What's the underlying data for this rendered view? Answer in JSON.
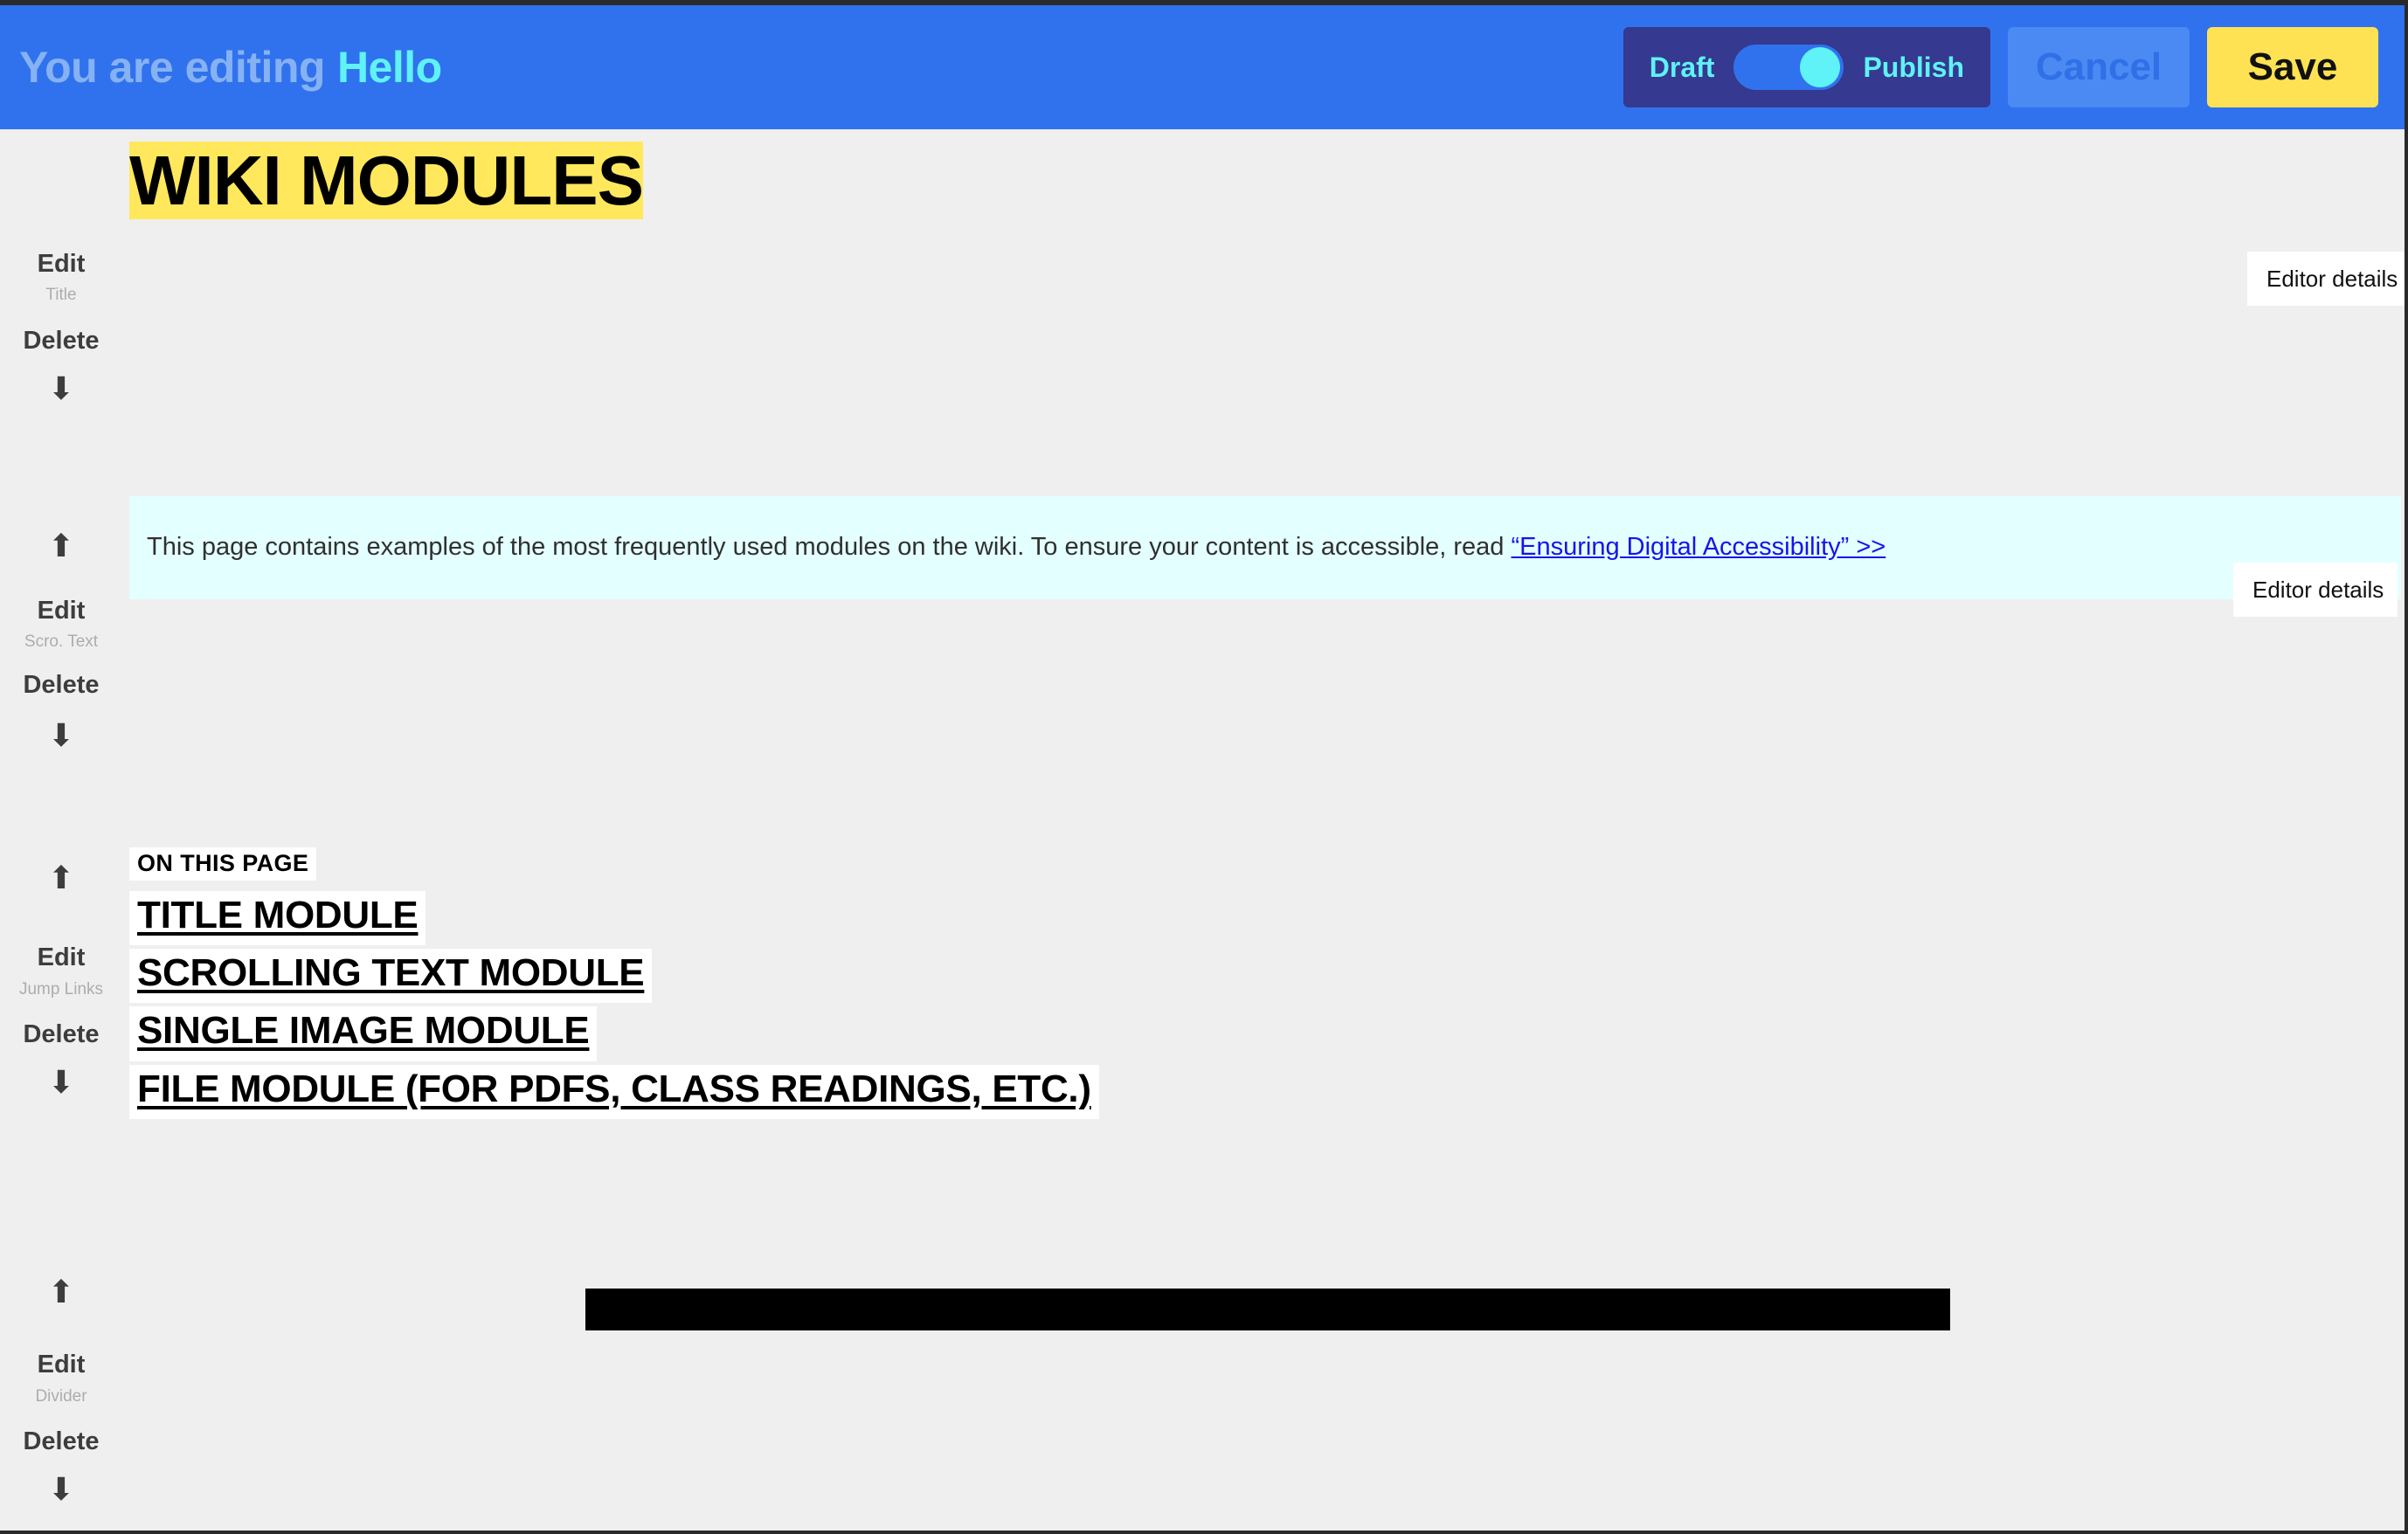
{
  "edit_bar": {
    "lead_text": "You are editing",
    "page_name": "Hello",
    "draft_label": "Draft",
    "publish_label": "Publish",
    "toggle_state": "publish",
    "cancel_label": "Cancel",
    "save_label": "Save",
    "colors": {
      "bar_background": "#3072ee",
      "lead_text": "#86b2f4",
      "page_name": "#5ff2f7",
      "toggle_group_background": "#35398f",
      "toggle_track": "#3072ee",
      "toggle_knob": "#5ff2f7",
      "cancel_background": "#4a8af2",
      "cancel_text": "#2f6fe8",
      "save_background": "#ffe253",
      "save_text": "#111111"
    }
  },
  "common": {
    "edit_label": "Edit",
    "delete_label": "Delete",
    "move_up_icon": "arrow-up-icon",
    "move_down_icon": "arrow-down-icon",
    "move_up_glyph": "⬆",
    "move_down_glyph": "⬇",
    "editor_details_label": "Editor details"
  },
  "page_background": "#efefef",
  "modules": [
    {
      "type_label": "Title",
      "name": "title-module",
      "has_move_up": false,
      "has_move_down": true,
      "title_text": "WIKI MODULES",
      "highlight_color": "#ffe85c",
      "has_editor_details": true
    },
    {
      "type_label": "Scro. Text",
      "name": "scrolling-text-module",
      "has_move_up": true,
      "has_move_down": true,
      "background_color": "#e4ffff",
      "body_text_before": "This page contains examples of the most frequently used modules on the wiki. To ensure your content is accessible, read ",
      "link_text": "“Ensuring Digital Accessibility” >>",
      "link_color": "#1414ee",
      "has_editor_details": true
    },
    {
      "type_label": "Jump Links",
      "name": "jump-links-module",
      "has_move_up": true,
      "has_move_down": true,
      "heading": "ON THIS PAGE",
      "links": [
        "TITLE MODULE",
        "SCROLLING TEXT MODULE",
        "SINGLE IMAGE MODULE",
        "FILE MODULE (FOR PDFS, CLASS READINGS, ETC.)"
      ],
      "has_editor_details": false
    },
    {
      "type_label": "Divider",
      "name": "divider-module",
      "has_move_up": true,
      "has_move_down": true,
      "divider_color": "#000000",
      "has_editor_details": false
    }
  ]
}
